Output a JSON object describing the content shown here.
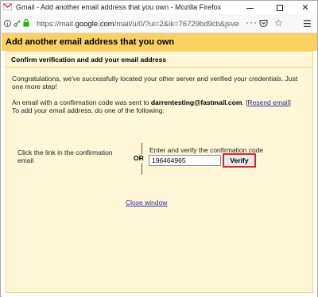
{
  "window": {
    "title": "Gmail - Add another email address that you own - Mozilla Firefox"
  },
  "urlbar": {
    "url_prefix": "https://mail.",
    "url_domain": "google.com",
    "url_suffix": "/mail/u/0/?ui=2&ik=76729bd9cb&jsver=D:"
  },
  "dialog": {
    "title": "Add another email address that you own",
    "subheading": "Confirm verification and add your email address",
    "congrats_text": "Congratulations, we've successfully located your other server and verified your credentials. Just one more step!",
    "sent_text_prefix": "An email with a confirmation code was sent to ",
    "email": "darrentesting@fastmail.com",
    "sent_text_mid": ". [",
    "resend_link": "Resend email",
    "sent_text_end": "]",
    "add_text": "To add your email address, do one of the following:",
    "option1_text": "Click the link in the confirmation email",
    "or_text": "OR",
    "option2_text": "Enter and verify the confirmation code",
    "code_value": "196464965",
    "verify_button": "Verify",
    "close_link": "Close window"
  },
  "colors": {
    "banner": "#fad163",
    "panel": "#fff7d7",
    "highlight": "#e0202e",
    "link": "#2a2aa6"
  }
}
